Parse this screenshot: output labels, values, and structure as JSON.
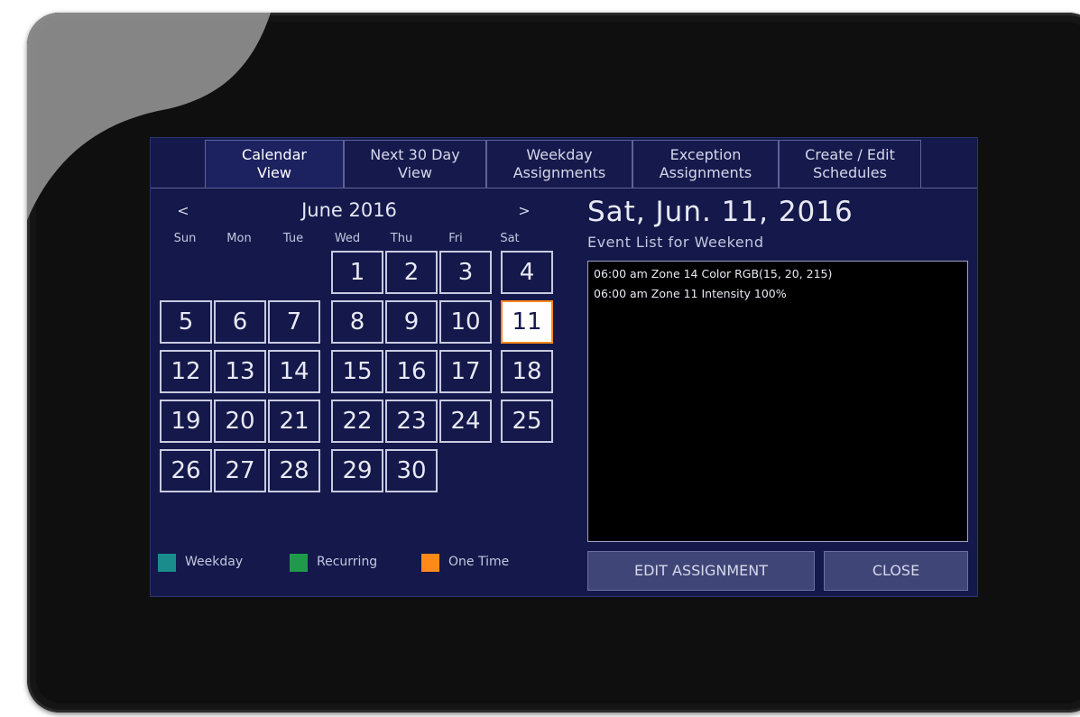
{
  "tabs": [
    {
      "label": "Calendar\nView",
      "active": true
    },
    {
      "label": "Next 30 Day\nView",
      "active": false
    },
    {
      "label": "Weekday\nAssignments",
      "active": false
    },
    {
      "label": "Exception\nAssignments",
      "active": false
    },
    {
      "label": "Create / Edit\nSchedules",
      "active": false
    }
  ],
  "calendar": {
    "prev_label": "<",
    "next_label": ">",
    "month_title": "June 2016",
    "weekdays": [
      "Sun",
      "Mon",
      "Tue",
      "Wed",
      "Thu",
      "Fri",
      "Sat"
    ],
    "days": [
      "1",
      "2",
      "3",
      "4",
      "5",
      "6",
      "7",
      "8",
      "9",
      "10",
      "11",
      "12",
      "13",
      "14",
      "15",
      "16",
      "17",
      "18",
      "19",
      "20",
      "21",
      "22",
      "23",
      "24",
      "25",
      "26",
      "27",
      "28",
      "29",
      "30"
    ],
    "selected_day": "11"
  },
  "legend": {
    "weekday_label": "Weekday",
    "weekday_color": "#1a8c8c",
    "recurring_label": "Recurring",
    "recurring_color": "#1f9a4a",
    "one_time_label": "One Time",
    "one_time_color": "#ff8a1a"
  },
  "detail": {
    "date_title": "Sat, Jun. 11, 2016",
    "event_list_label": "Event List for Weekend",
    "events": [
      "06:00 am  Zone 14 Color RGB(15, 20, 215)",
      "06:00 am  Zone 11 Intensity 100%"
    ],
    "edit_button": "EDIT ASSIGNMENT",
    "close_button": "CLOSE"
  }
}
